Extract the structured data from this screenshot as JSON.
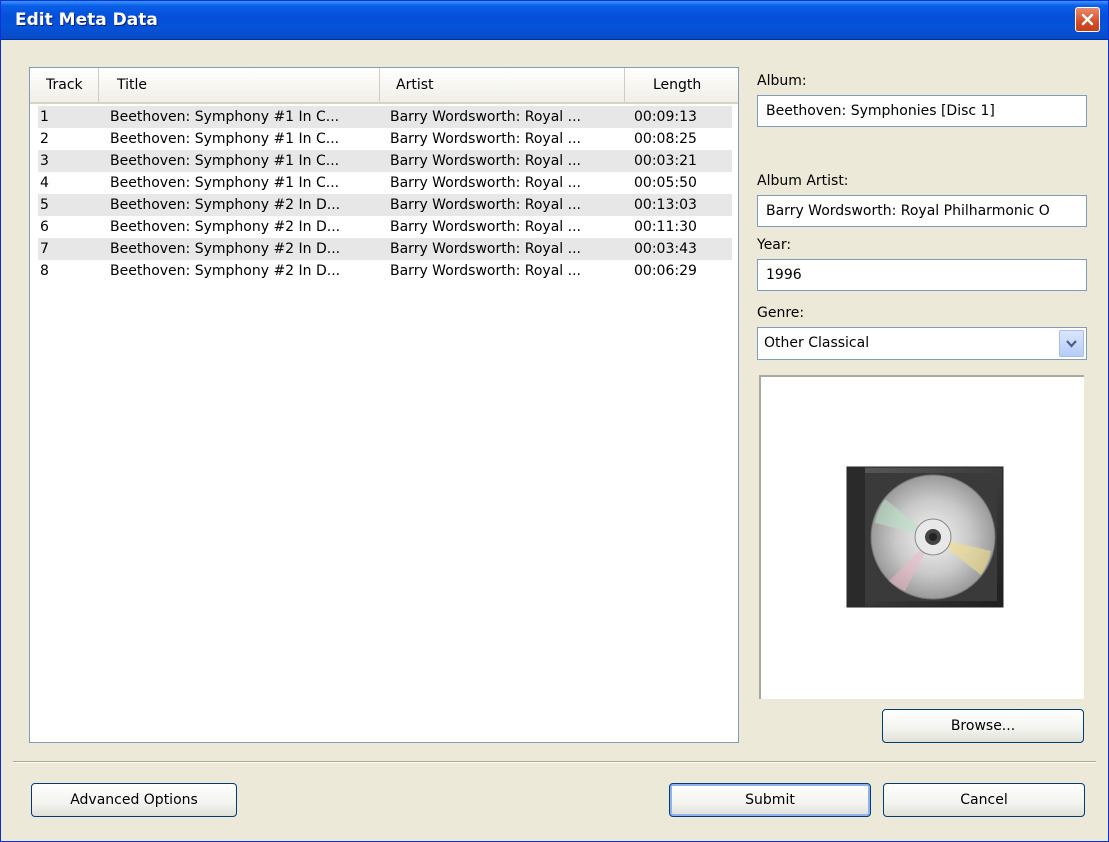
{
  "window": {
    "title": "Edit Meta Data"
  },
  "tracklist": {
    "columns": {
      "track": "Track",
      "title": "Title",
      "artist": "Artist",
      "length": "Length"
    },
    "rows": [
      {
        "track": "1",
        "title": "Beethoven: Symphony #1 In C...",
        "artist": "Barry Wordsworth: Royal ...",
        "length": "00:09:13"
      },
      {
        "track": "2",
        "title": "Beethoven: Symphony #1 In C...",
        "artist": "Barry Wordsworth: Royal ...",
        "length": "00:08:25"
      },
      {
        "track": "3",
        "title": "Beethoven: Symphony #1 In C...",
        "artist": "Barry Wordsworth: Royal ...",
        "length": "00:03:21"
      },
      {
        "track": "4",
        "title": "Beethoven: Symphony #1 In C...",
        "artist": "Barry Wordsworth: Royal ...",
        "length": "00:05:50"
      },
      {
        "track": "5",
        "title": "Beethoven: Symphony #2 In D...",
        "artist": "Barry Wordsworth: Royal ...",
        "length": "00:13:03"
      },
      {
        "track": "6",
        "title": "Beethoven: Symphony #2 In D...",
        "artist": "Barry Wordsworth: Royal ...",
        "length": "00:11:30"
      },
      {
        "track": "7",
        "title": "Beethoven: Symphony #2 In D...",
        "artist": "Barry Wordsworth: Royal ...",
        "length": "00:03:43"
      },
      {
        "track": "8",
        "title": "Beethoven: Symphony #2 In D...",
        "artist": "Barry Wordsworth: Royal ...",
        "length": "00:06:29"
      }
    ]
  },
  "form": {
    "album_label": "Album:",
    "album_value": "Beethoven: Symphonies [Disc 1]",
    "album_artist_label": "Album Artist:",
    "album_artist_value": "Barry Wordsworth: Royal Philharmonic O",
    "year_label": "Year:",
    "year_value": "1996",
    "genre_label": "Genre:",
    "genre_value": "Other Classical"
  },
  "buttons": {
    "browse": "Browse...",
    "advanced": "Advanced Options",
    "submit": "Submit",
    "cancel": "Cancel"
  },
  "icons": {
    "close": "close-icon",
    "dropdown": "chevron-down-icon",
    "album_art": "cd-case-icon"
  },
  "colors": {
    "titlebar": "#0452d8",
    "dialog_bg": "#ece9d8",
    "close_button": "#d4502a",
    "field_border": "#7f9db9",
    "alt_row": "#e7e7e7"
  }
}
